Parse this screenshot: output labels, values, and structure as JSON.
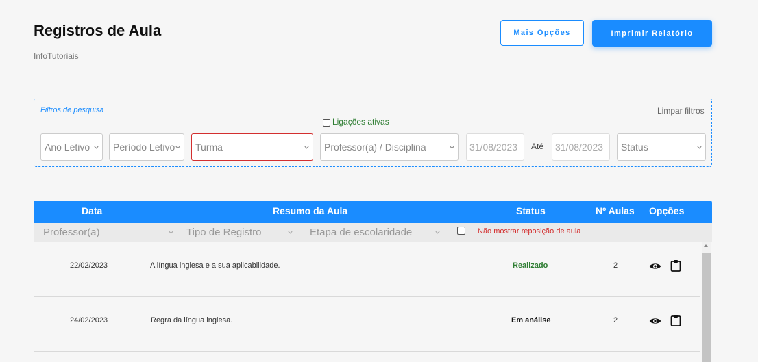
{
  "header": {
    "title": "Registros de Aula",
    "subtitle": "InfoTutoriais",
    "more_options_label": "Mais Opções",
    "print_report_label": "Imprimir Relatório"
  },
  "filters": {
    "section_label": "Filtros de pesquisa",
    "clear_label": "Limpar filtros",
    "active_links_label": "Ligações ativas",
    "ano_letivo": "Ano Letivo",
    "periodo_letivo": "Período Letivo",
    "turma": "Turma",
    "professor_disciplina": "Professor(a) / Disciplina",
    "date_from": "31/08/2023",
    "date_separator": "Até",
    "date_to": "31/08/2023",
    "status": "Status"
  },
  "table": {
    "columns": {
      "data": "Data",
      "resumo": "Resumo da Aula",
      "status": "Status",
      "n_aulas": "Nº Aulas",
      "opcoes": "Opções"
    },
    "subfilters": {
      "professor": "Professor(a)",
      "tipo_registro": "Tipo de Registro",
      "etapa": "Etapa de escolaridade",
      "no_reposition_label": "Não mostrar reposição de aula"
    },
    "rows": [
      {
        "date": "22/02/2023",
        "summary": "A língua inglesa e a sua aplicabilidade.",
        "status": "Realizado",
        "status_color": "#2e7d32",
        "aulas": "2"
      },
      {
        "date": "24/02/2023",
        "summary": "Regra da língua inglesa.",
        "status": "Em análise",
        "status_color": "#111111",
        "aulas": "2"
      }
    ]
  },
  "colors": {
    "accent": "#1a8cff",
    "error": "#d32f2f",
    "success": "#2e7d32"
  },
  "icons": {
    "view": "eye-icon",
    "report": "clipboard-icon",
    "dropdown": "chevron-down-icon"
  }
}
